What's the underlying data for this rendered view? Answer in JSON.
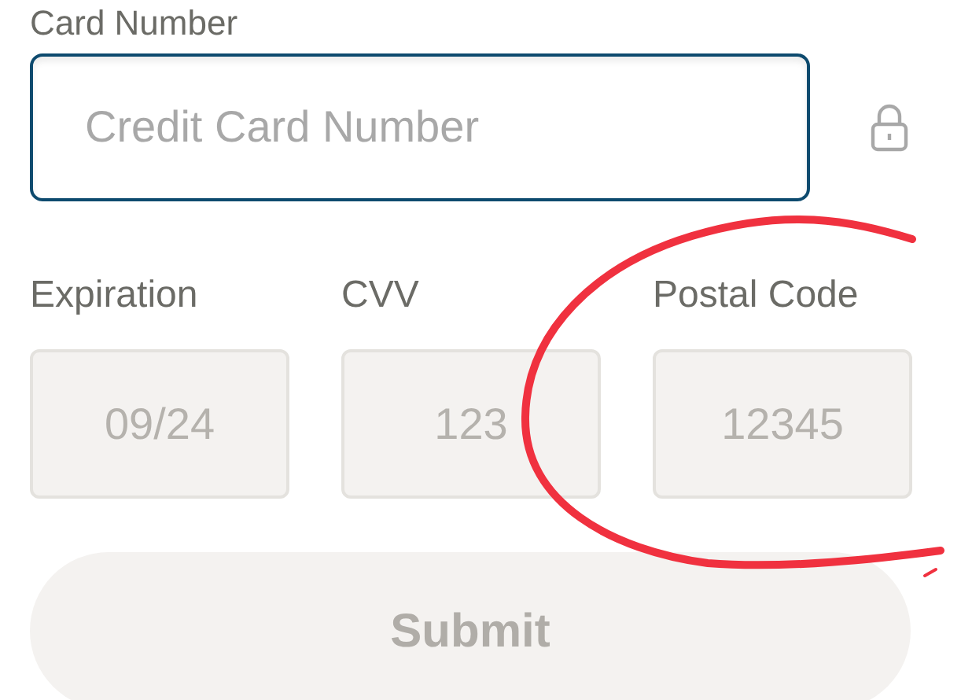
{
  "card_number": {
    "label": "Card Number",
    "placeholder": "Credit Card Number",
    "focused": true
  },
  "fields": [
    {
      "label": "Expiration",
      "placeholder": "09/24",
      "disabled": true
    },
    {
      "label": "CVV",
      "placeholder": "123",
      "disabled": true
    },
    {
      "label": "Postal Code",
      "placeholder": "12345",
      "disabled": true
    }
  ],
  "submit": {
    "label": "Submit",
    "disabled": true
  }
}
